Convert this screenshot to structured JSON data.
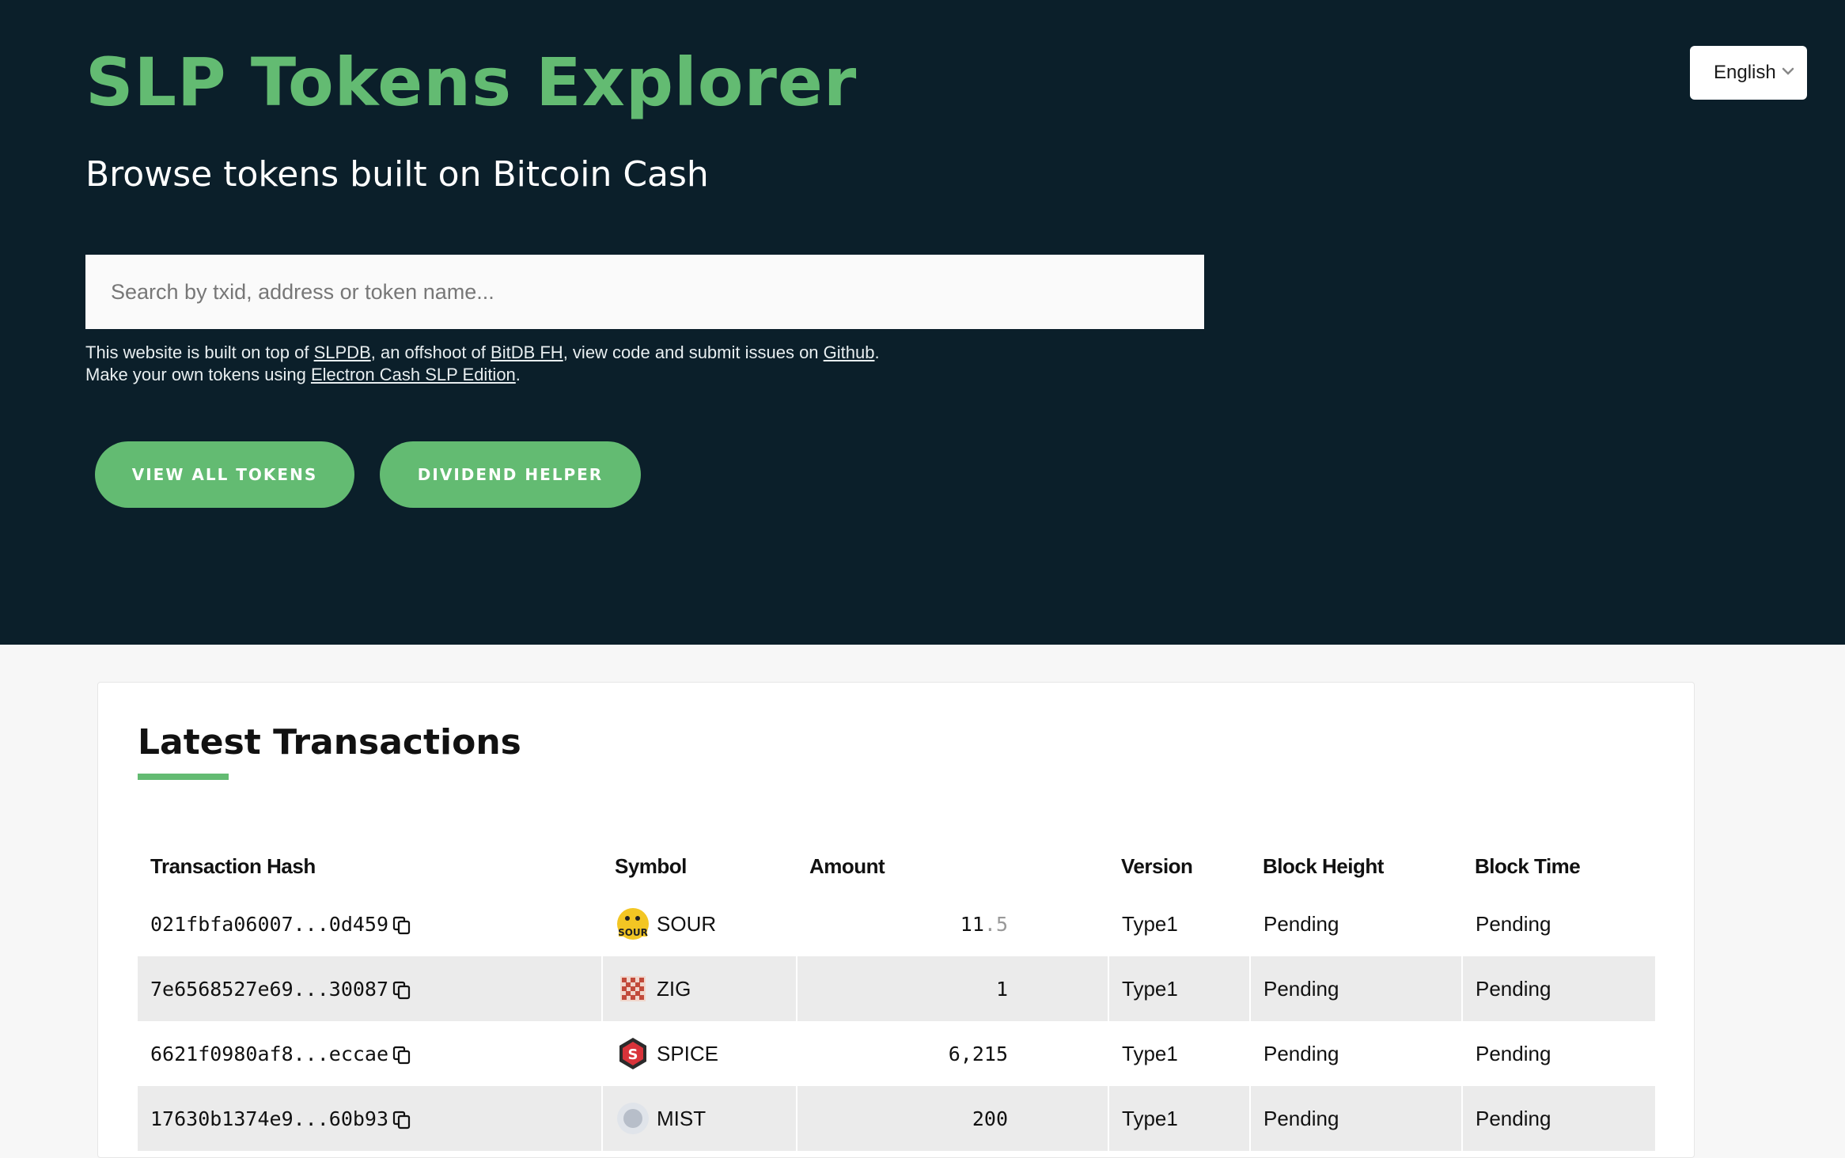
{
  "header": {
    "title": "SLP Tokens Explorer",
    "subtitle": "Browse tokens built on Bitcoin Cash",
    "language": "English",
    "search_placeholder": "Search by txid, address or token name...",
    "info": {
      "line1_a": "This website is built on top of ",
      "link_slpdb": "SLPDB",
      "line1_b": ", an offshoot of ",
      "link_bitdb": "BitDB FH",
      "line1_c": ", view code and submit issues on ",
      "link_github": "Github",
      "line1_d": ".",
      "line2_a": "Make your own tokens using ",
      "link_electron": "Electron Cash SLP Edition",
      "line2_b": "."
    },
    "buttons": {
      "view_all": "VIEW ALL TOKENS",
      "dividend": "DIVIDEND HELPER"
    }
  },
  "latest": {
    "title": "Latest Transactions",
    "columns": [
      "Transaction Hash",
      "Symbol",
      "Amount",
      "Version",
      "Block Height",
      "Block Time"
    ],
    "rows": [
      {
        "hash": "021fbfa06007...0d459",
        "symbol": "SOUR",
        "amount_int": "11",
        "amount_dec": ".5",
        "version": "Type1",
        "height": "Pending",
        "time": "Pending"
      },
      {
        "hash": "7e6568527e69...30087",
        "symbol": "ZIG",
        "amount_int": "1",
        "amount_dec": "",
        "version": "Type1",
        "height": "Pending",
        "time": "Pending"
      },
      {
        "hash": "6621f0980af8...eccae",
        "symbol": "SPICE",
        "amount_int": "6,215",
        "amount_dec": "",
        "version": "Type1",
        "height": "Pending",
        "time": "Pending"
      },
      {
        "hash": "17630b1374e9...60b93",
        "symbol": "MIST",
        "amount_int": "200",
        "amount_dec": "",
        "version": "Type1",
        "height": "Pending",
        "time": "Pending"
      }
    ]
  },
  "colors": {
    "accent": "#63bb72",
    "hero_bg": "#0b1f2a"
  },
  "icons": [
    "chevron-down-icon",
    "copy-icon",
    "sour-token-icon",
    "zig-token-icon",
    "spice-token-icon",
    "mist-token-icon"
  ]
}
